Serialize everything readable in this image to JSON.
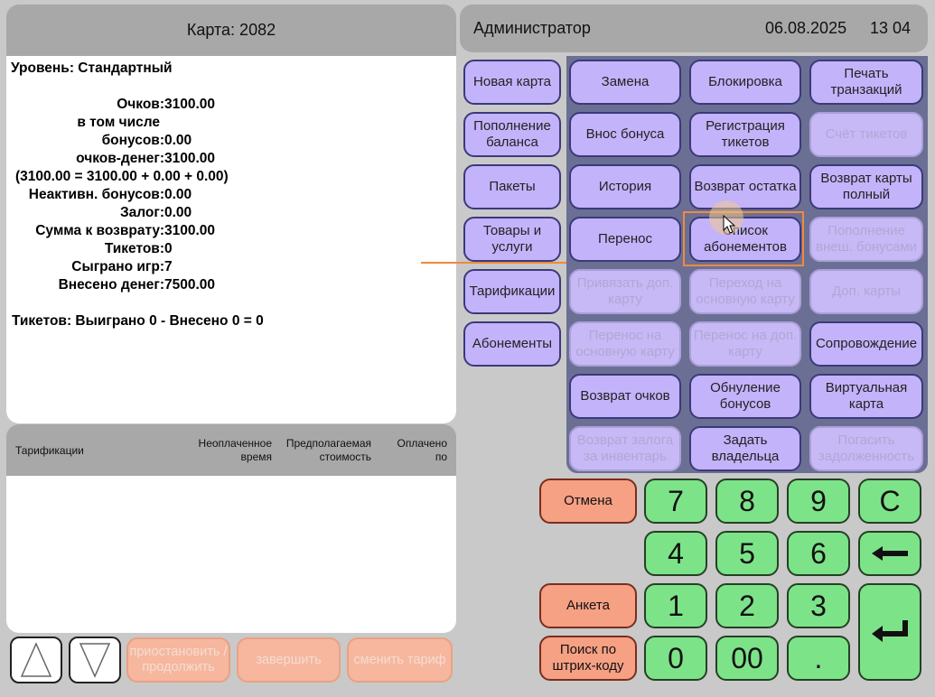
{
  "left_header": {
    "card": "Карта: 2082"
  },
  "right_header": {
    "user": "Администратор",
    "date": "06.08.2025",
    "time": "13 04"
  },
  "info": {
    "level": "Уровень: Стандартный",
    "rows": [
      {
        "label": "Очков:",
        "value": "3100.00"
      },
      {
        "label": "в том числе",
        "value": ""
      },
      {
        "label": "бонусов:",
        "value": "0.00"
      },
      {
        "label": "очков-денег:",
        "value": "3100.00"
      },
      {
        "label": "(3100.00 = 3100.00 + 0.00 + 0.00)",
        "value": ""
      },
      {
        "label": "Неактивн. бонусов:",
        "value": "0.00"
      },
      {
        "label": "Залог:",
        "value": "0.00"
      },
      {
        "label": "Сумма к возврату:",
        "value": "3100.00"
      },
      {
        "label": "Тикетов:",
        "value": "0"
      },
      {
        "label": "Сыграно игр:",
        "value": "7"
      },
      {
        "label": "Внесено денег:",
        "value": "7500.00"
      }
    ],
    "tickets_summary": "Тикетов: Выиграно 0 - Внесено 0 = 0"
  },
  "table": {
    "col1": "Тарификации",
    "col2": "Неоплаченное время",
    "col3": "Предполагаемая стоимость",
    "col4": "Оплачено по"
  },
  "bottom": {
    "pause": "приостановить / продолжить",
    "finish": "завершить",
    "change": "сменить тариф"
  },
  "left_buttons": [
    "Новая карта",
    "Пополнение баланса",
    "Пакеты",
    "Товары и услуги",
    "Тарификации",
    "Абонементы"
  ],
  "grid": [
    [
      "Замена",
      "Блокировка",
      "Печать транзакций"
    ],
    [
      "Внос бонуса",
      "Регистрация тикетов",
      "Счёт тикетов"
    ],
    [
      "История",
      "Возврат остатка",
      "Возврат карты полный"
    ],
    [
      "Перенос",
      "Список абонементов",
      "Пополнение внеш. бонусами"
    ],
    [
      "Привязать доп. карту",
      "Переход на основную карту",
      "Доп. карты"
    ],
    [
      "Перенос на основную карту",
      "Перенос на доп. карту",
      "Сопровождение"
    ],
    [
      "Возврат очков",
      "Обнуление бонусов",
      "Виртуальная карта"
    ],
    [
      "Возврат залога за инвентарь",
      "Задать владельца",
      "Погасить задолженность"
    ]
  ],
  "action_buttons": {
    "cancel": "Отмена",
    "form": "Анкета",
    "barcode": "Поиск по штрих-коду"
  },
  "keypad": {
    "k7": "7",
    "k8": "8",
    "k9": "9",
    "kc": "C",
    "k4": "4",
    "k5": "5",
    "k6": "6",
    "k1": "1",
    "k2": "2",
    "k3": "3",
    "k0": "0",
    "k00": "00",
    "kdot": "."
  },
  "colors": {
    "button_purple": "#c3b3fb",
    "keypad_green": "#7de389",
    "action_orange": "#f6a084",
    "highlight": "#f08a3c"
  }
}
